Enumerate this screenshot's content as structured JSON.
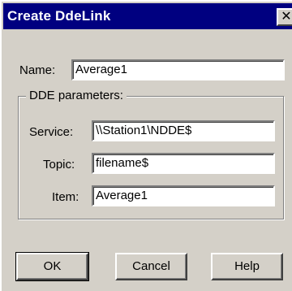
{
  "window": {
    "title": "Create DdeLink",
    "close_glyph": "✕"
  },
  "name_field": {
    "label": "Name:",
    "value": "Average1"
  },
  "dde_group": {
    "legend": "DDE parameters:",
    "service": {
      "label": "Service:",
      "value": "\\\\Station1\\NDDE$"
    },
    "topic": {
      "label": "Topic:",
      "value": "filename$"
    },
    "item": {
      "label": "Item:",
      "value": "Average1"
    }
  },
  "buttons": {
    "ok": "OK",
    "cancel": "Cancel",
    "help": "Help"
  }
}
